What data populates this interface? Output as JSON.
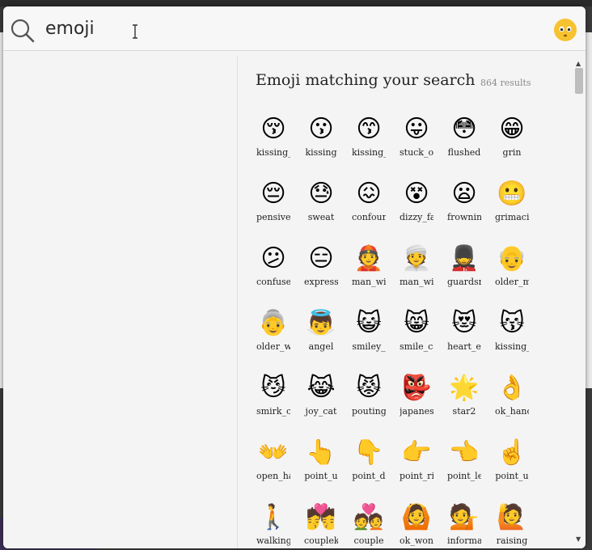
{
  "search": {
    "value": "emoji",
    "placeholder": ""
  },
  "heading": "Emoji matching your search",
  "result_count": "864 results",
  "icons": {
    "search": "search-icon",
    "app": "emoji-app-icon",
    "cursor": "text-cursor-icon"
  },
  "colors": {
    "accent_face": "#f6c230",
    "window_bg": "#f4f4f4",
    "scrollbar_thumb": "#bdbdbd"
  },
  "emoji": [
    {
      "glyph": "😚",
      "label": "kissing_"
    },
    {
      "glyph": "😗",
      "label": "kissing"
    },
    {
      "glyph": "😙",
      "label": "kissing_"
    },
    {
      "glyph": "😛",
      "label": "stuck_o"
    },
    {
      "glyph": "😳",
      "label": "flushed"
    },
    {
      "glyph": "😁",
      "label": "grin"
    },
    {
      "glyph": "😔",
      "label": "pensive"
    },
    {
      "glyph": "😓",
      "label": "sweat"
    },
    {
      "glyph": "😖",
      "label": "confoun"
    },
    {
      "glyph": "😵",
      "label": "dizzy_fa"
    },
    {
      "glyph": "😦",
      "label": "frownin"
    },
    {
      "glyph": "😬",
      "label": "grimaci"
    },
    {
      "glyph": "😕",
      "label": "confuse"
    },
    {
      "glyph": "😑",
      "label": "express"
    },
    {
      "glyph": "👲",
      "label": "man_wi"
    },
    {
      "glyph": "👳",
      "label": "man_wi"
    },
    {
      "glyph": "💂",
      "label": "guardsr"
    },
    {
      "glyph": "👴",
      "label": "older_m"
    },
    {
      "glyph": "👵",
      "label": "older_w"
    },
    {
      "glyph": "👼",
      "label": "angel"
    },
    {
      "glyph": "😺",
      "label": "smiley_"
    },
    {
      "glyph": "😸",
      "label": "smile_ca"
    },
    {
      "glyph": "😻",
      "label": "heart_e"
    },
    {
      "glyph": "😽",
      "label": "kissing_"
    },
    {
      "glyph": "😼",
      "label": "smirk_c"
    },
    {
      "glyph": "😹",
      "label": "joy_cat"
    },
    {
      "glyph": "😾",
      "label": "pouting"
    },
    {
      "glyph": "👺",
      "label": "japanes"
    },
    {
      "glyph": "🌟",
      "label": "star2"
    },
    {
      "glyph": "👌",
      "label": "ok_hanc"
    },
    {
      "glyph": "👐",
      "label": "open_ha"
    },
    {
      "glyph": "👆",
      "label": "point_u"
    },
    {
      "glyph": "👇",
      "label": "point_d"
    },
    {
      "glyph": "👉",
      "label": "point_ri"
    },
    {
      "glyph": "👈",
      "label": "point_le"
    },
    {
      "glyph": "☝️",
      "label": "point_u"
    },
    {
      "glyph": "🚶",
      "label": "walking"
    },
    {
      "glyph": "💏",
      "label": "couplek"
    },
    {
      "glyph": "💑",
      "label": "couple"
    },
    {
      "glyph": "🙆",
      "label": "ok_won"
    },
    {
      "glyph": "💁",
      "label": "informa"
    },
    {
      "glyph": "🙋",
      "label": "raising"
    }
  ]
}
